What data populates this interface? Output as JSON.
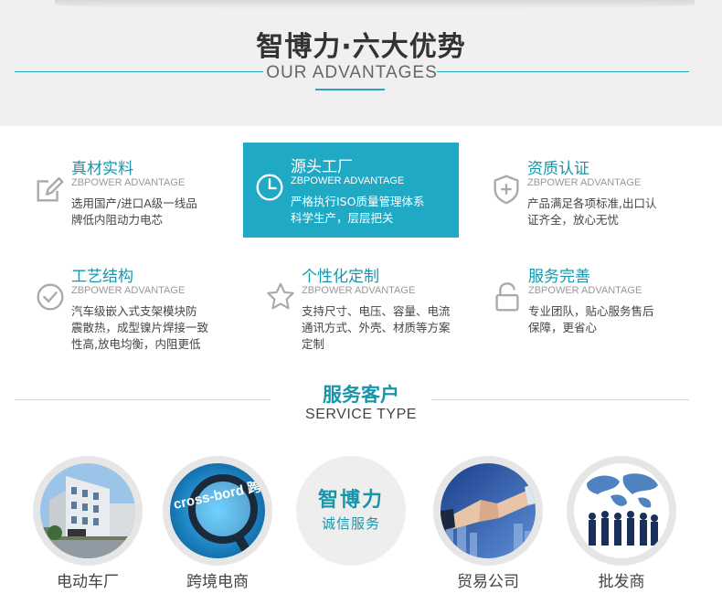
{
  "header": {
    "title": "智博力·六大优势",
    "subtitle": "OUR ADVANTAGES"
  },
  "advantages": [
    {
      "title": "真材实料",
      "subtitle": "ZBPOWER ADVANTAGE",
      "lines": [
        "选用国产/进口A级一线品",
        "牌低内阻动力电芯"
      ],
      "icon": "edit-icon"
    },
    {
      "title": "源头工厂",
      "subtitle": "ZBPOWER ADVANTAGE",
      "lines": [
        "严格执行ISO质量管理体系",
        "科学生产，层层把关"
      ],
      "icon": "clock-icon",
      "highlighted": true
    },
    {
      "title": "资质认证",
      "subtitle": "ZBPOWER ADVANTAGE",
      "lines": [
        "产品满足各项标准,出口认",
        "证齐全，放心无忧"
      ],
      "icon": "shield-plus-icon"
    },
    {
      "title": "工艺结构",
      "subtitle": "ZBPOWER ADVANTAGE",
      "lines": [
        "汽车级嵌入式支架模块防",
        "震散热，成型镍片焊接一致",
        "性高,放电均衡，内阻更低"
      ],
      "icon": "check-circle-icon"
    },
    {
      "title": "个性化定制",
      "subtitle": "ZBPOWER ADVANTAGE",
      "lines": [
        "支持尺寸、电压、容量、电流",
        "通讯方式、外壳、材质等方案",
        "定制"
      ],
      "icon": "star-icon"
    },
    {
      "title": "服务完善",
      "subtitle": "ZBPOWER ADVANTAGE",
      "lines": [
        "专业团队，贴心服务售后",
        "保障，更省心"
      ],
      "icon": "lock-icon"
    }
  ],
  "service": {
    "title": "服务客户",
    "subtitle": "SERVICE TYPE",
    "brand": {
      "name": "智博力",
      "tagline": "诚信服务"
    },
    "clients": [
      {
        "label": "电动车厂",
        "image_text": ""
      },
      {
        "label": "跨境电商",
        "image_text": "cross-bord 跨境电商"
      },
      {
        "label": "贸易公司",
        "image_text": ""
      },
      {
        "label": "批发商",
        "image_text": ""
      }
    ]
  },
  "colors": {
    "accent": "#1fa9c4",
    "accent_text": "#1796ab",
    "header_bg": "#f0f0f0",
    "icon": "#aaaaaa"
  }
}
